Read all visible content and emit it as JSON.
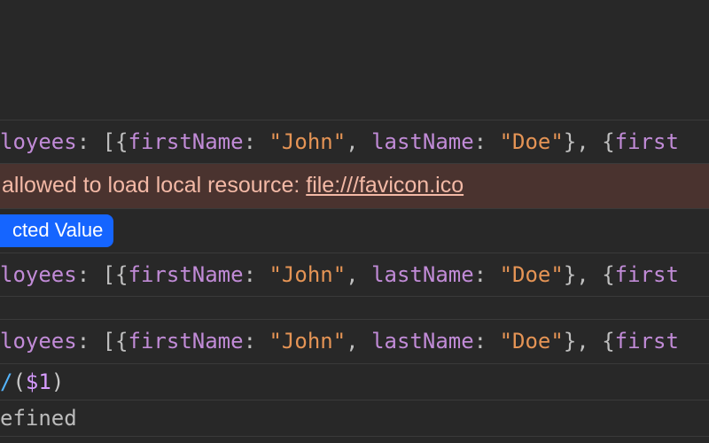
{
  "lines": {
    "obj1": {
      "prop": "loyees",
      "k1": "firstName",
      "v1": "\"John\"",
      "k2": "lastName",
      "v2": "\"Doe\"",
      "k3": "first"
    },
    "obj2": {
      "prop": "loyees",
      "k1": "firstName",
      "v1": "\"John\"",
      "k2": "lastName",
      "v2": "\"Doe\"",
      "k3": "first"
    },
    "obj3": {
      "prop": "loyees",
      "k1": "firstName",
      "v1": "\"John\"",
      "k2": "lastName",
      "v2": "\"Doe\"",
      "k3": "first"
    }
  },
  "error": {
    "prefix": "allowed to load local resource: ",
    "link": "file:///favicon.ico"
  },
  "badge": {
    "label": "cted Value"
  },
  "fn": {
    "name": "/",
    "arg": "$1"
  },
  "tail": {
    "text": "efined"
  },
  "punct": {
    "colonSpace": ": ",
    "openArrObj": "[{",
    "commaSpace": ", ",
    "closeObjComma": "}, ",
    "openObj": "{",
    "lparen": "(",
    "rparen": ")"
  }
}
